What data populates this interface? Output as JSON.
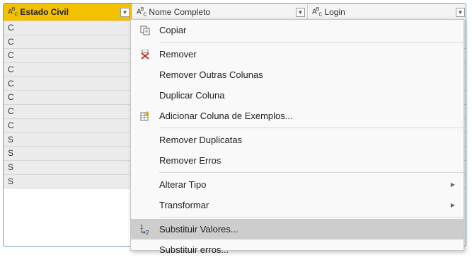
{
  "columns": [
    {
      "type_icon": "ABC",
      "name": "Estado Civil",
      "selected": true
    },
    {
      "type_icon": "ABC",
      "name": "Nome Completo",
      "selected": false
    },
    {
      "type_icon": "ABC",
      "name": "Login",
      "selected": false
    }
  ],
  "rows": [
    "C",
    "C",
    "C",
    "C",
    "C",
    "C",
    "C",
    "C",
    "S",
    "S",
    "S",
    "S"
  ],
  "menu": {
    "copy": "Copiar",
    "remove": "Remover",
    "remove_other": "Remover Outras Colunas",
    "duplicate": "Duplicar Coluna",
    "add_examples": "Adicionar Coluna de Exemplos...",
    "remove_duplicates": "Remover Duplicatas",
    "remove_errors": "Remover Erros",
    "change_type": "Alterar Tipo",
    "transform": "Transformar",
    "replace_values": "Substituir Valores...",
    "replace_errors": "Substituir erros..."
  },
  "icons": {
    "copy": "copy-icon",
    "remove": "remove-x-icon",
    "add_examples": "add-column-examples-icon",
    "replace_values": "replace-values-icon",
    "submenu": "chevron-right-icon",
    "dropdown": "chevron-down-icon"
  },
  "colors": {
    "selected_header": "#f2c100",
    "highlight": "#cdcdcd",
    "remove_x": "#c42b1c"
  }
}
